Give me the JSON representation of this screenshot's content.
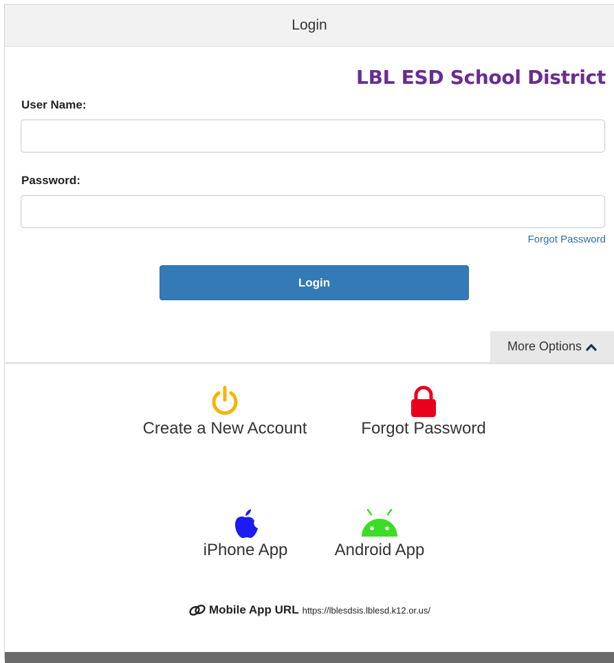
{
  "header": {
    "title": "Login"
  },
  "district_name": "LBL ESD School District",
  "form": {
    "username_label": "User Name:",
    "username_value": "",
    "password_label": "Password:",
    "password_value": "",
    "forgot_link": "Forgot Password",
    "login_button": "Login"
  },
  "more_options": {
    "label": "More Options"
  },
  "options": {
    "create_account": "Create a New Account",
    "forgot_password": "Forgot Password",
    "iphone_app": "iPhone App",
    "android_app": "Android App"
  },
  "mobile_app_url": {
    "label": "Mobile App URL",
    "value": "https://lblesdsis.lblesd.k12.or.us/"
  },
  "colors": {
    "district": "#6a2c91",
    "login_button": "#337ab7",
    "power_icon": "#f5b400",
    "lock_icon": "#e8001c",
    "apple_icon": "#1b1bf2",
    "android_icon": "#3ddc26"
  },
  "icons": [
    "power-icon",
    "lock-icon",
    "apple-icon",
    "android-icon",
    "link-icon",
    "chevron-up-icon"
  ]
}
